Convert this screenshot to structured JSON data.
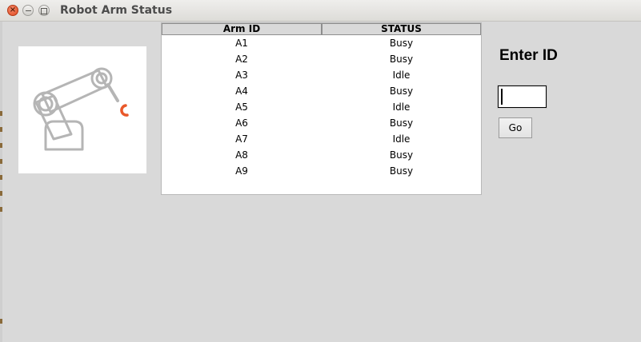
{
  "window": {
    "title": "Robot Arm Status",
    "close_glyph": "×"
  },
  "image": {
    "icon": "robot-arm-icon",
    "arm_color": "#b5b5b5",
    "gripper_color": "#e9582a"
  },
  "table": {
    "columns": [
      "Arm ID",
      "STATUS"
    ],
    "rows": [
      {
        "id": "A1",
        "status": "Busy"
      },
      {
        "id": "A2",
        "status": "Busy"
      },
      {
        "id": "A3",
        "status": "Idle"
      },
      {
        "id": "A4",
        "status": "Busy"
      },
      {
        "id": "A5",
        "status": "Idle"
      },
      {
        "id": "A6",
        "status": "Busy"
      },
      {
        "id": "A7",
        "status": "Idle"
      },
      {
        "id": "A8",
        "status": "Busy"
      },
      {
        "id": "A9",
        "status": "Busy"
      }
    ]
  },
  "form": {
    "prompt": "Enter ID",
    "input_value": "",
    "go_label": "Go"
  }
}
